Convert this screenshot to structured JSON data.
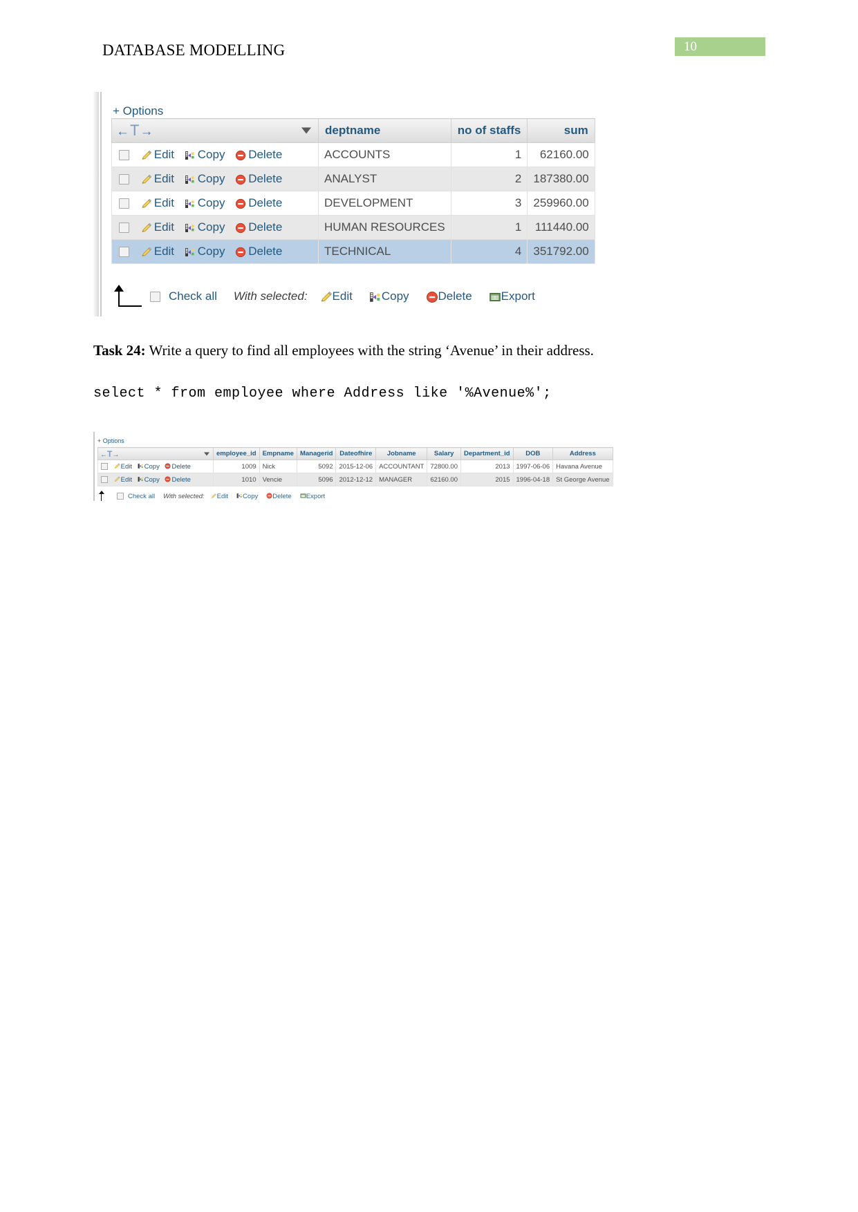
{
  "document": {
    "header_title": "DATABASE MODELLING",
    "page_number": "10"
  },
  "colors": {
    "page_badge_bg": "#a9d18e",
    "link_blue": "#235a81",
    "header_text_blue": "#235a81",
    "row_alt_bg": "#e8e8e8",
    "row_hover_bg": "#b8cfe5"
  },
  "result_table_1": {
    "options_label": "+ Options",
    "nav": {
      "prev": "←",
      "t": "T",
      "next": "→"
    },
    "columns": [
      "deptname",
      "no of staffs",
      "sum"
    ],
    "actions": {
      "edit": "Edit",
      "copy": "Copy",
      "delete": "Delete"
    },
    "rows": [
      {
        "deptname": "ACCOUNTS",
        "staffs": "1",
        "sum": "62160.00"
      },
      {
        "deptname": "ANALYST",
        "staffs": "2",
        "sum": "187380.00"
      },
      {
        "deptname": "DEVELOPMENT",
        "staffs": "3",
        "sum": "259960.00"
      },
      {
        "deptname": "HUMAN RESOURCES",
        "staffs": "1",
        "sum": "111440.00"
      },
      {
        "deptname": "TECHNICAL",
        "staffs": "4",
        "sum": "351792.00"
      }
    ],
    "footer": {
      "check_all": "Check all",
      "with_selected": "With selected:",
      "edit": "Edit",
      "copy": "Copy",
      "delete": "Delete",
      "export": "Export"
    }
  },
  "task": {
    "label": "Task 24:",
    "text": " Write a query to find all employees with the string ‘Avenue’ in their address.",
    "sql": "select * from employee where Address like '%Avenue%';"
  },
  "result_table_2": {
    "options_label": "+ Options",
    "nav": {
      "prev": "←",
      "t": "T",
      "next": "→"
    },
    "columns": [
      "employee_id",
      "Empname",
      "Managerid",
      "Dateofhire",
      "Jobname",
      "Salary",
      "Department_id",
      "DOB",
      "Address"
    ],
    "actions": {
      "edit": "Edit",
      "copy": "Copy",
      "delete": "Delete"
    },
    "rows": [
      {
        "employee_id": "1009",
        "empname": "Nick",
        "managerid": "5092",
        "dateofhire": "2015-12-06",
        "jobname": "ACCOUNTANT",
        "salary": "72800.00",
        "department_id": "2013",
        "dob": "1997-06-06",
        "address": "Havana Avenue"
      },
      {
        "employee_id": "1010",
        "empname": "Vencie",
        "managerid": "5096",
        "dateofhire": "2012-12-12",
        "jobname": "MANAGER",
        "salary": "62160.00",
        "department_id": "2015",
        "dob": "1996-04-18",
        "address": "St George Avenue"
      }
    ],
    "footer": {
      "check_all": "Check all",
      "with_selected": "With selected:",
      "edit": "Edit",
      "copy": "Copy",
      "delete": "Delete",
      "export": "Export"
    }
  }
}
